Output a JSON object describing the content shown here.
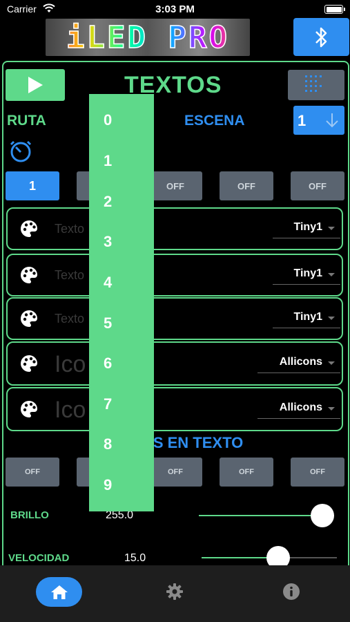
{
  "status_bar": {
    "carrier": "Carrier",
    "time": "3:03 PM"
  },
  "logo": {
    "text": "iLED PRO"
  },
  "header": {
    "title": "TEXTOS"
  },
  "ruta": {
    "label": "RUTA"
  },
  "escena": {
    "label": "ESCENA",
    "value": "1"
  },
  "route_buttons": [
    "1",
    "OFF",
    "OFF",
    "OFF",
    "OFF"
  ],
  "text_rows": [
    {
      "placeholder": "Texto",
      "font": "Tiny1"
    },
    {
      "placeholder": "Texto",
      "font": "Tiny1"
    },
    {
      "placeholder": "Texto",
      "font": "Tiny1"
    },
    {
      "placeholder": "Ico",
      "font": "Allicons"
    },
    {
      "placeholder": "Ico",
      "font": "Allicons"
    }
  ],
  "efectos": {
    "title": "OS EN TEXTO",
    "buttons": [
      "OFF",
      "OFF",
      "OFF",
      "OFF",
      "OFF"
    ]
  },
  "sliders": [
    {
      "label": "BRILLO",
      "value": "255.0",
      "level": 1.0
    },
    {
      "label": "VELOCIDAD",
      "value": "15.0",
      "level": 0.58
    }
  ],
  "dropdown": {
    "options": [
      "0",
      "1",
      "2",
      "3",
      "4",
      "5",
      "6",
      "7",
      "8",
      "9"
    ]
  },
  "tabs": [
    {
      "name": "home",
      "icon": "home-icon",
      "active": true
    },
    {
      "name": "settings",
      "icon": "gear-icon",
      "active": false
    },
    {
      "name": "info",
      "icon": "info-icon",
      "active": false
    }
  ],
  "colors": {
    "accent_green": "#5ed98a",
    "accent_blue": "#2f8ef0",
    "button_gray": "#5a6470"
  }
}
